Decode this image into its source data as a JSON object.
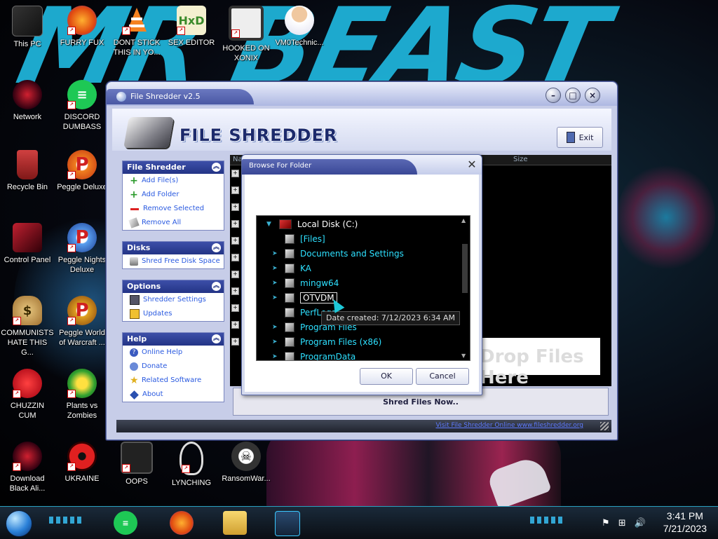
{
  "wallpaper": {
    "text": "MR BEAST"
  },
  "desktop_icons": [
    {
      "label": "This PC"
    },
    {
      "label": "FURRY FUX"
    },
    {
      "label": "DONT STICK THIS IN YO..."
    },
    {
      "label": "SEX EDITOR"
    },
    {
      "label": "HOOKED ON XONIX"
    },
    {
      "label": "VM0Technic..."
    },
    {
      "label": "Network"
    },
    {
      "label": "DISCORD DUMBASS"
    },
    {
      "label": "Recycle Bin"
    },
    {
      "label": "Peggle Deluxe"
    },
    {
      "label": "Control Panel"
    },
    {
      "label": "Peggle Nights Deluxe"
    },
    {
      "label": "COMMUNISTS HATE THIS G..."
    },
    {
      "label": "Peggle World of Warcraft ..."
    },
    {
      "label": "CHUZZIN CUM"
    },
    {
      "label": "Plants vs Zombies"
    },
    {
      "label": "Download Black Ali..."
    },
    {
      "label": "UKRAINE"
    },
    {
      "label": "OOPS"
    },
    {
      "label": "LYNCHING"
    },
    {
      "label": "RansomWar..."
    }
  ],
  "window": {
    "title": "File Shredder v2.5",
    "logo_text": "FILE SHREDDER",
    "exit_label": "Exit",
    "panels": [
      {
        "title": "File Shredder",
        "items": [
          "Add File(s)",
          "Add Folder",
          "Remove Selected",
          "Remove All"
        ]
      },
      {
        "title": "Disks",
        "items": [
          "Shred Free Disk Space"
        ]
      },
      {
        "title": "Options",
        "items": [
          "Shredder Settings",
          "Updates"
        ]
      },
      {
        "title": "Help",
        "items": [
          "Online Help",
          "Donate",
          "Related Software",
          "About"
        ]
      }
    ],
    "columns": {
      "name": "Na",
      "size": "Size"
    },
    "drop_hint": "Drop Files Here",
    "shred_button": "Shred Files Now..",
    "status_link": "Visit File Shredder Online   www.fileshredder.org"
  },
  "dialog": {
    "title": "Browse For Folder",
    "tree": [
      {
        "name": "Local Disk (C:)",
        "expanded": true
      },
      {
        "name": "[Files]"
      },
      {
        "name": "Documents and Settings"
      },
      {
        "name": "KA"
      },
      {
        "name": "mingw64"
      },
      {
        "name": "OTVDM",
        "selected": true
      },
      {
        "name": "PerfLogs"
      },
      {
        "name": "Program Files"
      },
      {
        "name": "Program Files (x86)"
      },
      {
        "name": "ProgramData"
      }
    ],
    "tooltip": "Date created: 7/12/2023 6:34 AM",
    "ok_label": "OK",
    "cancel_label": "Cancel"
  },
  "taskbar": {
    "time": "3:41 PM",
    "date": "7/21/2023"
  }
}
